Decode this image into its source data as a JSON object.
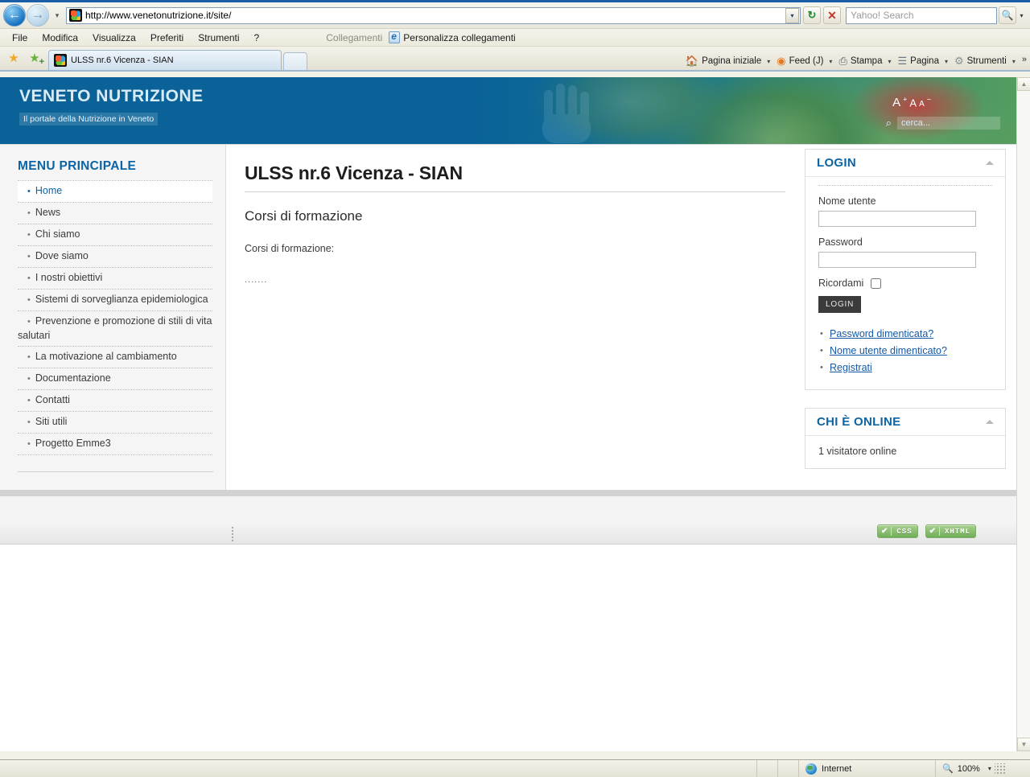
{
  "browser": {
    "url": "http://www.venetonutrizione.it/site/",
    "search_placeholder": "Yahoo! Search",
    "back_glyph": "←",
    "forward_glyph": "→",
    "history_caret": "▾",
    "url_caret": "▾",
    "refresh_glyph": "↻",
    "stop_glyph": "✕",
    "search_go_glyph": "🔍",
    "search_caret": "▾",
    "menu": [
      "File",
      "Modifica",
      "Visualizza",
      "Preferiti",
      "Strumenti",
      "?"
    ],
    "links_label": "Collegamenti",
    "customize_links": "Personalizza collegamenti",
    "tab_title": "ULSS nr.6 Vicenza - SIAN",
    "favorites_star": "★",
    "add_favorite": "★",
    "commands": [
      {
        "label": "Pagina iniziale",
        "icon": "🏠",
        "caret": "▾"
      },
      {
        "label": "Feed (J)",
        "icon": "◉",
        "caret": "▾"
      },
      {
        "label": "Stampa",
        "icon": "⎙",
        "caret": "▾"
      },
      {
        "label": "Pagina",
        "icon": "☰",
        "caret": "▾"
      },
      {
        "label": "Strumenti",
        "icon": "⚙",
        "caret": "▾"
      }
    ],
    "overflow": "»",
    "scroll_up": "▲",
    "scroll_down": "▼"
  },
  "site": {
    "title": "VENETO NUTRIZIONE",
    "subtitle": "Il portale della Nutrizione in Veneto",
    "font_increase": "A",
    "font_normal": "A",
    "font_decrease": "A",
    "font_plus": "+",
    "font_minus": "−",
    "search_icon": "⌕",
    "search_placeholder": "cerca..."
  },
  "sidebar": {
    "title": "MENU PRINCIPALE",
    "bullet": "•",
    "items": [
      {
        "label": "Home",
        "active": true
      },
      {
        "label": "News",
        "active": false
      },
      {
        "label": "Chi siamo",
        "active": false
      },
      {
        "label": "Dove siamo",
        "active": false
      },
      {
        "label": "I nostri obiettivi",
        "active": false
      },
      {
        "label": "Sistemi di sorveglianza epidemiologica",
        "active": false
      },
      {
        "label": "Prevenzione e promozione di stili di vita salutari",
        "active": false
      },
      {
        "label": "La motivazione al cambiamento",
        "active": false
      },
      {
        "label": "Documentazione",
        "active": false
      },
      {
        "label": "Contatti",
        "active": false
      },
      {
        "label": "Siti utili",
        "active": false
      },
      {
        "label": "Progetto Emme3",
        "active": false
      }
    ]
  },
  "content": {
    "page_title": "ULSS nr.6 Vicenza - SIAN",
    "article_title": "Corsi di formazione",
    "paragraph_1": "Corsi di formazione:",
    "paragraph_2": "......."
  },
  "login_panel": {
    "title": "LOGIN",
    "collapse_icon": "collapse-arrow",
    "username_label": "Nome utente",
    "username_value": "",
    "password_label": "Password",
    "password_value": "",
    "remember_label": "Ricordami",
    "remember_checked": false,
    "submit_label": "LOGIN",
    "links": [
      "Password dimenticata?",
      "Nome utente dimenticato?",
      "Registrati"
    ]
  },
  "online_panel": {
    "title": "CHI È ONLINE",
    "collapse_icon": "collapse-arrow",
    "text": "1 visitatore online"
  },
  "footer": {
    "badges": [
      {
        "check": "✔",
        "label": "CSS"
      },
      {
        "check": "✔",
        "label": "XHTML"
      }
    ]
  },
  "statusbar": {
    "zone": "Internet",
    "zone_icon": "globe-icon",
    "zoom_icon": "🔍",
    "zoom_level": "100%",
    "zoom_caret": "▾"
  },
  "colors": {
    "brand_blue": "#0a6298",
    "link_blue": "#1459a8",
    "heading_blue": "#0b64a5",
    "sidebar_bg": "#f5f5f5",
    "badge_green": "#6fae58"
  }
}
